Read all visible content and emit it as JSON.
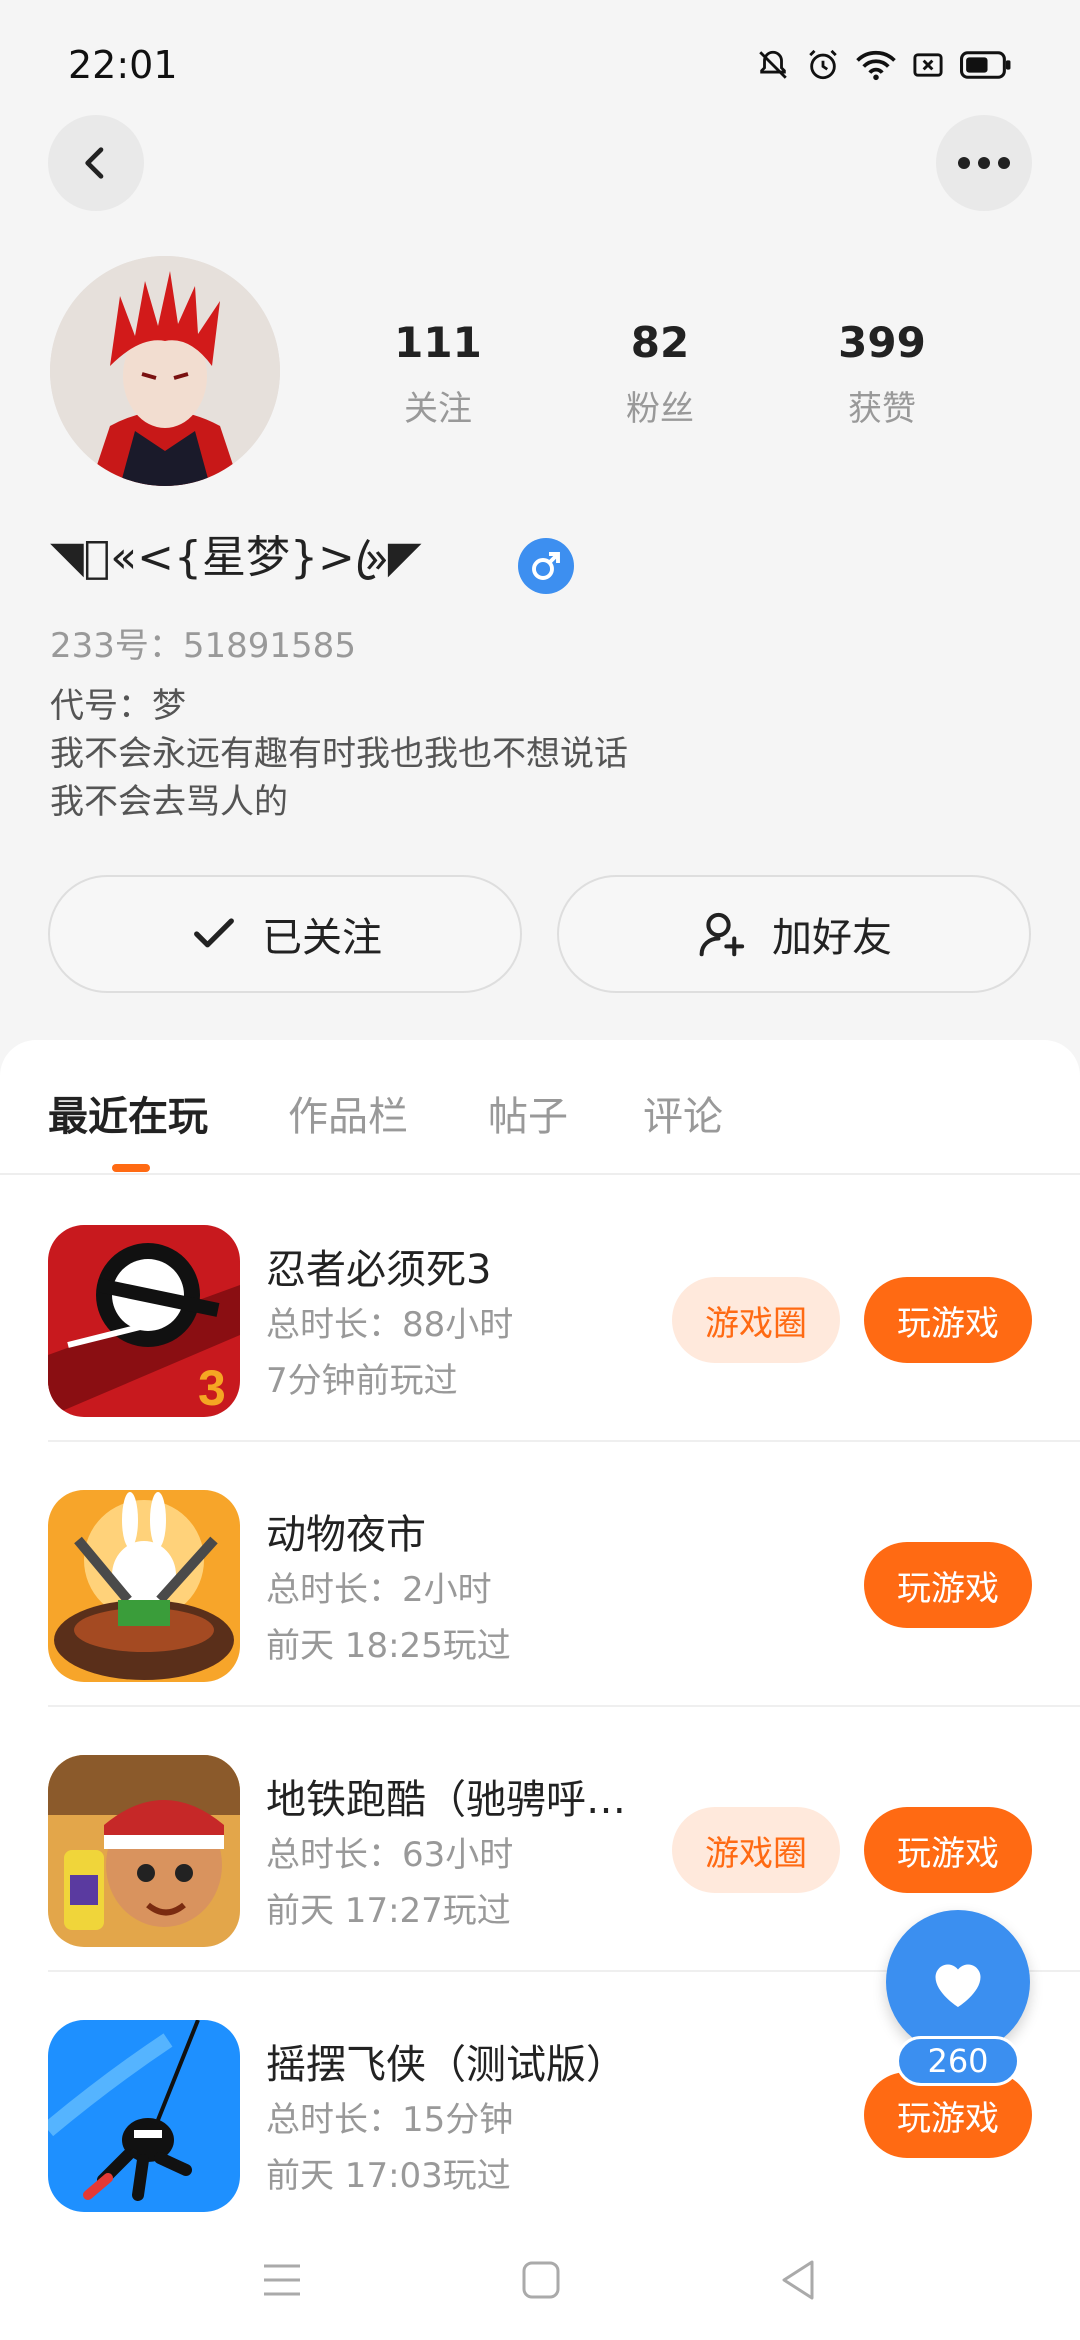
{
  "status_bar": {
    "time": "22:01",
    "icons": [
      "bell-off-icon",
      "alarm-icon",
      "wifi-icon",
      "sim-x-icon",
      "battery-icon"
    ]
  },
  "header": {
    "back_icon": "chevron-left-icon",
    "more_icon": "more-dots-icon"
  },
  "profile": {
    "stats": [
      {
        "value": "111",
        "label": "关注"
      },
      {
        "value": "82",
        "label": "粉丝"
      },
      {
        "value": "399",
        "label": "获赞"
      }
    ],
    "nickname": "◥ꦿ«<{星梦}>»ꦿ◤",
    "gender": "♂",
    "account_id": "233号：51891585",
    "bio": [
      "代号：梦",
      "我不会永远有趣有时我也我也不想说话",
      "我不会去骂人的"
    ]
  },
  "actions": {
    "follow_label": "已关注",
    "add_friend_label": "加好友"
  },
  "tabs": [
    {
      "label": "最近在玩",
      "active": true
    },
    {
      "label": "作品栏",
      "active": false
    },
    {
      "label": "帖子",
      "active": false
    },
    {
      "label": "评论",
      "active": false
    }
  ],
  "games": [
    {
      "title": "忍者必须死3",
      "duration": "总时长：88小时",
      "last_played": "7分钟前玩过",
      "has_circle": true,
      "circle_label": "游戏圈",
      "play_label": "玩游戏"
    },
    {
      "title": "动物夜市",
      "duration": "总时长：2小时",
      "last_played": "前天 18:25玩过",
      "has_circle": false,
      "play_label": "玩游戏"
    },
    {
      "title": "地铁跑酷（驰骋呼…",
      "duration": "总时长：63小时",
      "last_played": "前天 17:27玩过",
      "has_circle": true,
      "circle_label": "游戏圈",
      "play_label": "玩游戏"
    },
    {
      "title": "摇摆飞侠（测试版）",
      "duration": "总时长：15分钟",
      "last_played": "前天 17:03玩过",
      "has_circle": false,
      "play_label": "玩游戏"
    }
  ],
  "like_fab": {
    "count": "260",
    "icon": "heart-icon"
  },
  "colors": {
    "accent": "#ff6a13",
    "accent_light": "#ffe9dc",
    "blue": "#3b8ff0"
  }
}
